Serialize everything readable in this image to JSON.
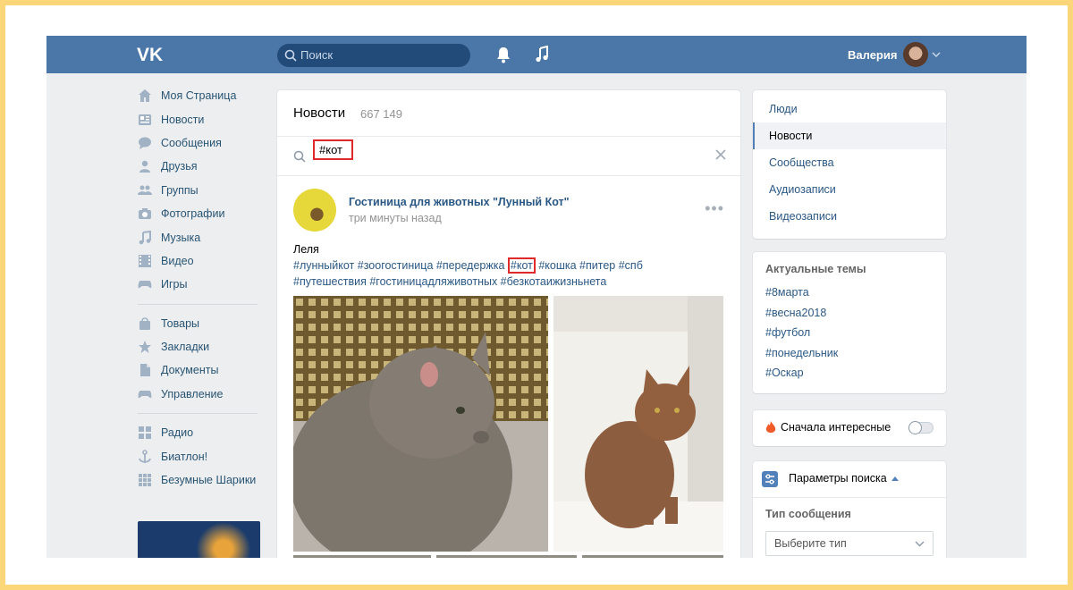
{
  "header": {
    "logo": "VK",
    "search_placeholder": "Поиск",
    "user_name": "Валерия"
  },
  "leftnav": {
    "group1": [
      {
        "label": "Моя Страница",
        "icon": "home-icon"
      },
      {
        "label": "Новости",
        "icon": "news-icon"
      },
      {
        "label": "Сообщения",
        "icon": "messages-icon"
      },
      {
        "label": "Друзья",
        "icon": "friends-icon"
      },
      {
        "label": "Группы",
        "icon": "groups-icon"
      },
      {
        "label": "Фотографии",
        "icon": "camera-icon"
      },
      {
        "label": "Музыка",
        "icon": "music-icon"
      },
      {
        "label": "Видео",
        "icon": "film-icon"
      },
      {
        "label": "Игры",
        "icon": "gamepad-icon"
      }
    ],
    "group2": [
      {
        "label": "Товары",
        "icon": "bag-icon"
      },
      {
        "label": "Закладки",
        "icon": "star-icon"
      },
      {
        "label": "Документы",
        "icon": "document-icon"
      },
      {
        "label": "Управление",
        "icon": "gamepad-icon"
      }
    ],
    "group3": [
      {
        "label": "Радио",
        "icon": "apps-icon"
      },
      {
        "label": "Биатлон!",
        "icon": "anchor-icon"
      },
      {
        "label": "Безумные Шарики",
        "icon": "grid-icon"
      }
    ]
  },
  "feed": {
    "title": "Новости",
    "count": "667 149",
    "query": "#кот",
    "post": {
      "author": "Гостиница для животных \"Лунный Кот\"",
      "time": "три минуты назад",
      "text_line": "Леля",
      "tags_line1_before": "#лунныйкот #зоогостиница #передержка ",
      "tags_highlight": "#кот",
      "tags_line1_after": " #кошка #питер #спб",
      "tags_line2": "#путешествия #гостиницадляживотных #безкотаижизньнета",
      "more": "•••"
    }
  },
  "filters": {
    "items": [
      "Люди",
      "Новости",
      "Сообщества",
      "Аудиозаписи",
      "Видеозаписи"
    ],
    "active_index": 1
  },
  "trends": {
    "title": "Актуальные темы",
    "items": [
      "#8марта",
      "#весна2018",
      "#футбол",
      "#понедельник",
      "#Оскар"
    ]
  },
  "sort": {
    "label": "Сначала интересные",
    "enabled": false
  },
  "params": {
    "title": "Параметры поиска",
    "type_label": "Тип сообщения",
    "type_value": "Выберите тип"
  },
  "colors": {
    "header": "#4a76a8",
    "link": "#2a5885",
    "highlight_border": "#e0292b",
    "frame": "#fbd77a"
  }
}
